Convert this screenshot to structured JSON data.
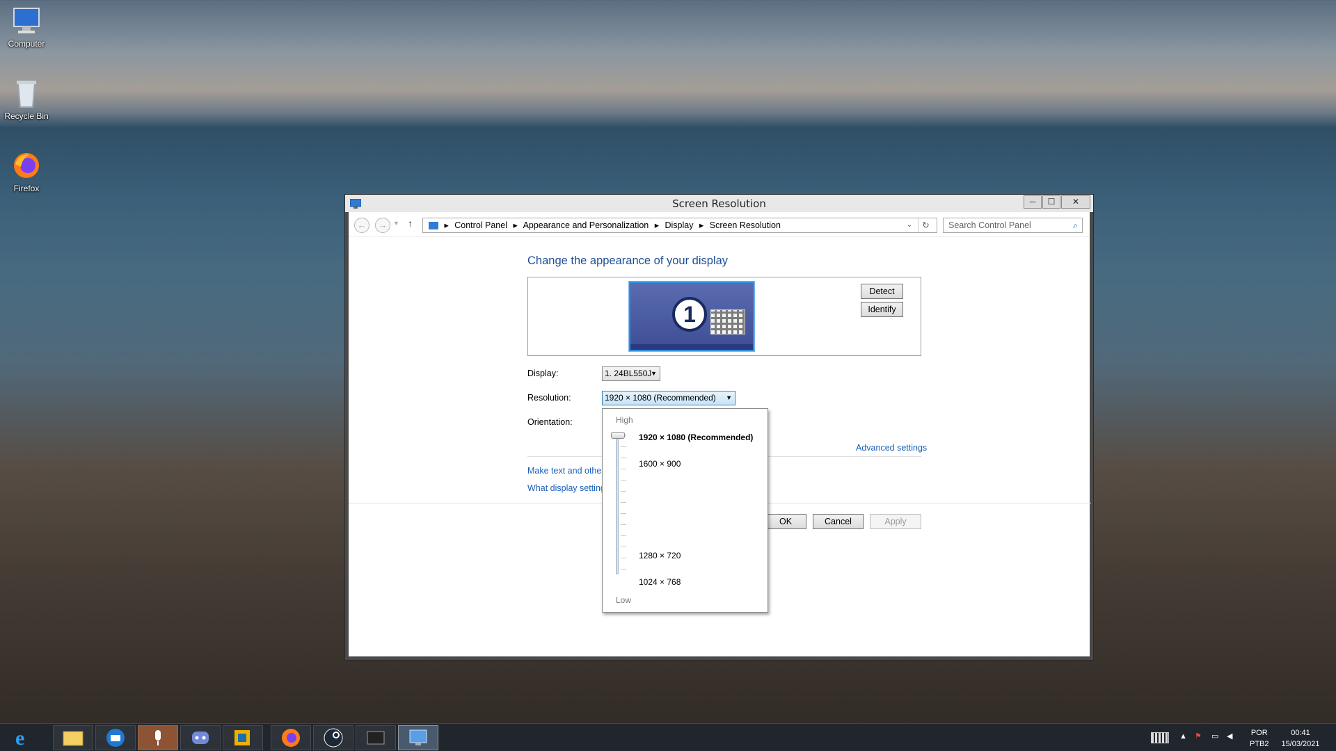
{
  "desktop": {
    "icons": [
      {
        "label": "Computer"
      },
      {
        "label": "Recycle Bin"
      },
      {
        "label": "Firefox"
      }
    ]
  },
  "window": {
    "title": "Screen Resolution",
    "controls": {
      "minimize": "─",
      "maximize": "☐",
      "close": "✕"
    },
    "address": [
      "Control Panel",
      "Appearance and Personalization",
      "Display",
      "Screen Resolution"
    ],
    "search_placeholder": "Search Control Panel",
    "heading": "Change the appearance of your display",
    "monitor_number": "1",
    "detect_label": "Detect",
    "identify_label": "Identify",
    "display_label": "Display:",
    "display_value": "1. 24BL550J",
    "resolution_label": "Resolution:",
    "resolution_value": "1920 × 1080 (Recommended)",
    "orientation_label": "Orientation:",
    "advanced_settings": "Advanced settings",
    "link_text_size": "Make text and other",
    "link_display_settings": "What display setting",
    "ok_label": "OK",
    "cancel_label": "Cancel",
    "apply_label": "Apply"
  },
  "resolution_dropdown": {
    "high_label": "High",
    "low_label": "Low",
    "options": [
      "1920 × 1080 (Recommended)",
      "1600 × 900",
      "1280 × 720",
      "1024 × 768"
    ],
    "selected_index": 0
  },
  "taskbar": {
    "apps": [
      "internet-explorer",
      "file-explorer",
      "thunderbird",
      "microphone",
      "discord",
      "vmware",
      "firefox",
      "steam",
      "terminal",
      "control-panel"
    ],
    "language": "POR",
    "layout": "PTB2",
    "time": "00:41",
    "date": "15/03/2021"
  },
  "colors": {
    "link": "#1b5fb6",
    "heading": "#1e4d9a",
    "monitor": "#3d4e96"
  }
}
